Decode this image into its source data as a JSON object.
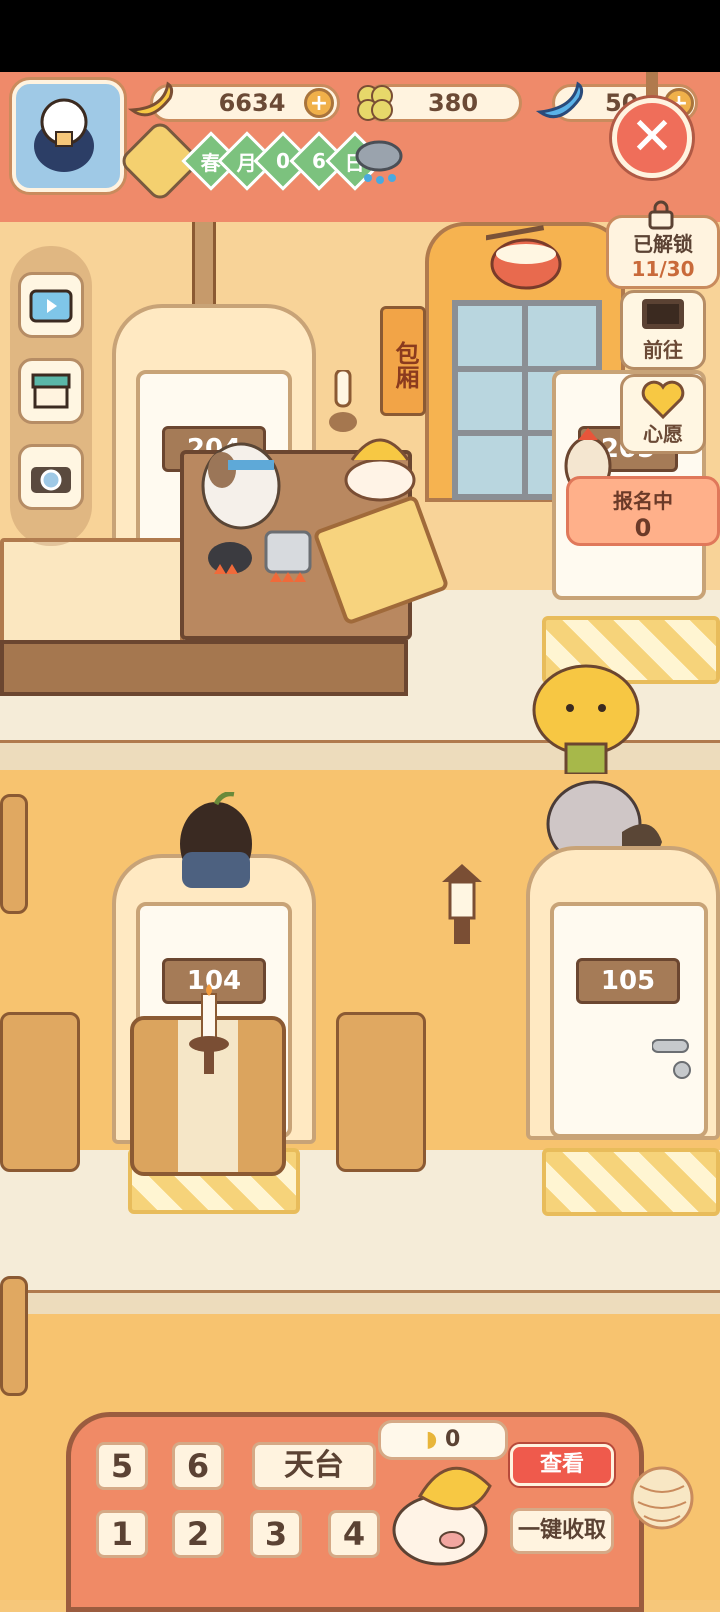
{
  "resources": {
    "banana": {
      "value": "6634",
      "icon": "banana-icon"
    },
    "clover": {
      "value": "380",
      "icon": "clover-icon"
    },
    "gem": {
      "value": "50",
      "icon": "blue-banana-icon"
    }
  },
  "date": {
    "season": "春",
    "month_label": "月",
    "day_digits": [
      "0",
      "6"
    ],
    "day_label": "日",
    "weather_icon": "rain-cloud-icon"
  },
  "side_menu": [
    "tv-icon",
    "shop-icon",
    "camera-icon"
  ],
  "right_panel": {
    "unlocked_label": "已解锁",
    "unlocked_count": "11/30",
    "goto_label": "前往",
    "wish_label": "心愿",
    "signup_label": "报名中",
    "signup_count": "0"
  },
  "rooms": {
    "r204": "204",
    "r205": "205",
    "r104": "104",
    "r105": "105",
    "private_room_sign": "包厢"
  },
  "bottom": {
    "floors_top": [
      "5",
      "6"
    ],
    "rooftop": "天台",
    "floors_bottom": [
      "1",
      "2",
      "3",
      "4"
    ],
    "collect_count": "0",
    "view_button": "查看",
    "collect_all_button": "一键收取"
  },
  "colors": {
    "hud": "#ef8a6a",
    "wall": "#f7c36f",
    "accent_red": "#ef5a4c",
    "wood": "#a57b57"
  }
}
